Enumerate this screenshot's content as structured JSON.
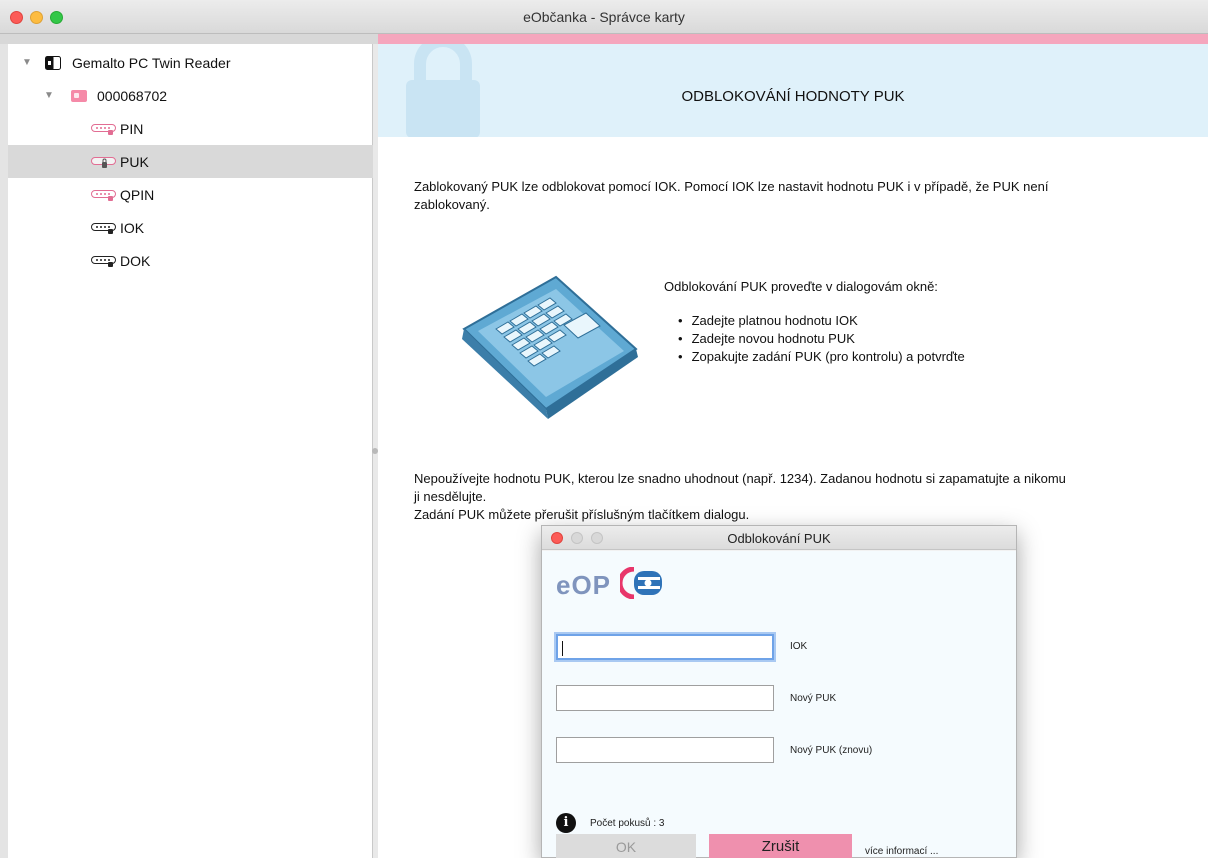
{
  "window": {
    "title": "eObčanka - Správce karty"
  },
  "tree": {
    "reader": "Gemalto PC Twin Reader",
    "card": "000068702",
    "items": [
      {
        "label": "PIN"
      },
      {
        "label": "PUK"
      },
      {
        "label": "QPIN"
      },
      {
        "label": "IOK"
      },
      {
        "label": "DOK"
      }
    ],
    "selected": "PUK"
  },
  "content": {
    "banner_title": "ODBLOKOVÁNÍ HODNOTY PUK",
    "intro_line1": "Zablokovaný PUK lze odblokovat pomocí IOK. Pomocí IOK lze nastavit hodnotu PUK i v případě, že PUK není",
    "intro_line2": "zablokovaný.",
    "instructions_heading": "Odblokování PUK proveďte v dialogovám okně:",
    "instructions": [
      "Zadejte platnou hodnotu IOK",
      "Zadejte novou hodnotu PUK",
      "Zopakujte zadání PUK (pro kontrolu) a potvrďte"
    ],
    "warning_line1": "Nepoužívejte hodnotu PUK, kterou lze snadno uhodnout (např. 1234). Zadanou hodnotu si zapamatujte a nikomu",
    "warning_line2": "ji nesdělujte.",
    "warning_line3": "Zadání PUK můžete přerušit příslušným tlačítkem dialogu."
  },
  "dialog": {
    "title": "Odblokování PUK",
    "logo": "eOP",
    "fields": [
      {
        "label": "IOK",
        "value": ""
      },
      {
        "label": "Nový PUK",
        "value": ""
      },
      {
        "label": "Nový PUK (znovu)",
        "value": ""
      }
    ],
    "attempts": "Počet pokusů : 3",
    "ok_label": "OK",
    "cancel_label": "Zrušit",
    "more_info": "více informací ..."
  },
  "colors": {
    "accent_pink": "#f5a6bd",
    "banner_blue": "#dff1fa",
    "cancel_pink": "#ef90ae",
    "focus_blue": "#6fa3e8"
  },
  "icons": {
    "reader": "card-reader-icon",
    "card": "smart-card-icon",
    "pin": "password-key-icon",
    "info": "info-icon",
    "illustration": "keypad-illustration"
  }
}
